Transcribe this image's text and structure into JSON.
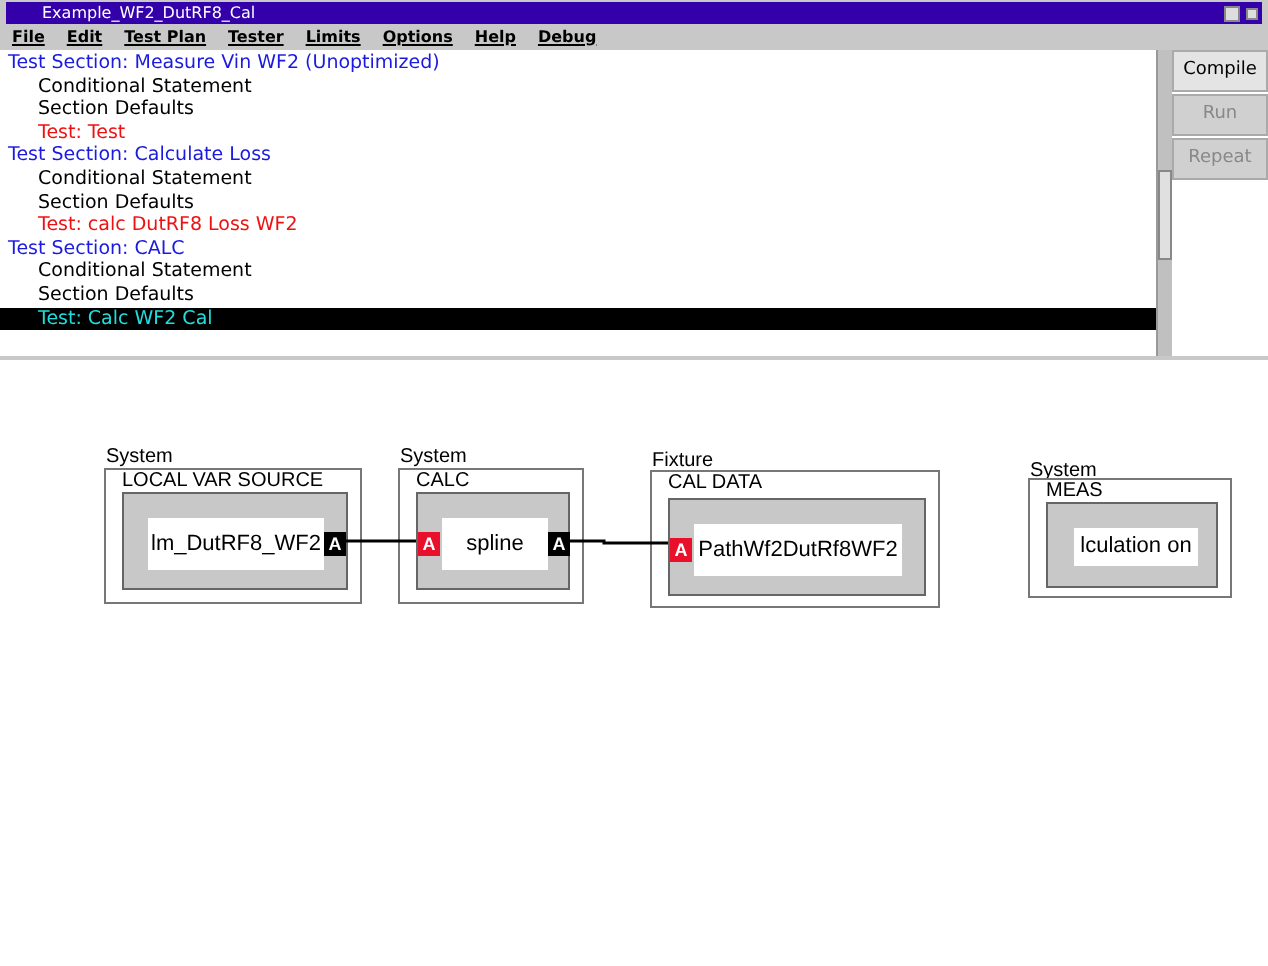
{
  "window": {
    "title": "Example_WF2_DutRF8_Cal"
  },
  "menu": [
    "File",
    "Edit",
    "Test Plan",
    "Tester",
    "Limits",
    "Options",
    "Help",
    "Debug"
  ],
  "tree": [
    {
      "kind": "section",
      "label": "Test Section: Measure Vin WF2 (Unoptimized)",
      "selected": false
    },
    {
      "kind": "item",
      "label": "Conditional Statement",
      "selected": false
    },
    {
      "kind": "item",
      "label": "Section Defaults",
      "selected": false
    },
    {
      "kind": "test",
      "label": "Test: Test",
      "selected": false
    },
    {
      "kind": "section",
      "label": "Test Section: Calculate Loss",
      "selected": false
    },
    {
      "kind": "item",
      "label": "Conditional Statement",
      "selected": false
    },
    {
      "kind": "item",
      "label": "Section Defaults",
      "selected": false
    },
    {
      "kind": "test",
      "label": "Test: calc DutRF8 Loss WF2",
      "selected": false
    },
    {
      "kind": "section",
      "label": "Test Section: CALC",
      "selected": false
    },
    {
      "kind": "item",
      "label": "Conditional Statement",
      "selected": false
    },
    {
      "kind": "item",
      "label": "Section Defaults",
      "selected": false
    },
    {
      "kind": "test",
      "label": "Test: Calc WF2 Cal",
      "selected": true
    }
  ],
  "buttons": [
    {
      "label": "Compile",
      "disabled": false
    },
    {
      "label": "Run",
      "disabled": true
    },
    {
      "label": "Repeat",
      "disabled": true
    }
  ],
  "diagram": {
    "blocks": [
      {
        "category": "System",
        "title": "LOCAL VAR SOURCE",
        "content": "lm_DutRF8_WF2",
        "ports": [
          {
            "kind": "out",
            "label": "A"
          }
        ]
      },
      {
        "category": "System",
        "title": "CALC",
        "content": "spline",
        "ports": [
          {
            "kind": "in",
            "label": "A"
          },
          {
            "kind": "out",
            "label": "A"
          }
        ]
      },
      {
        "category": "Fixture",
        "title": "CAL DATA",
        "content": "PathWf2DutRf8WF2",
        "ports": [
          {
            "kind": "in",
            "label": "A"
          }
        ]
      },
      {
        "category": "System",
        "title": "MEAS",
        "content": "lculation on"
      }
    ]
  }
}
